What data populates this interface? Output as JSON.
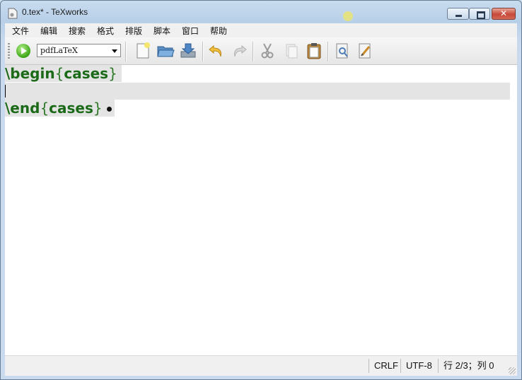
{
  "window": {
    "title": "0.tex* - TeXworks",
    "close_label": "✕"
  },
  "menu": {
    "items": [
      "文件",
      "编辑",
      "搜索",
      "格式",
      "排版",
      "脚本",
      "窗口",
      "帮助"
    ]
  },
  "toolbar": {
    "engine_value": "pdfLaTeX",
    "icons": [
      "typeset-icon",
      "new-file-icon",
      "open-folder-icon",
      "save-icon",
      "undo-icon",
      "redo-icon",
      "cut-icon",
      "copy-icon",
      "paste-icon",
      "find-icon",
      "replace-icon"
    ]
  },
  "editor": {
    "line1": {
      "command": "\\begin",
      "lbrace": "{",
      "arg": "cases",
      "rbrace": "}"
    },
    "line3": {
      "command": "\\end",
      "lbrace": "{",
      "arg": "cases",
      "rbrace": "}"
    }
  },
  "status": {
    "line_ending": "CRLF",
    "encoding": "UTF-8",
    "position": "行 2/3；列 0"
  },
  "colors": {
    "latex_green": "#1b6a18",
    "selection_gray": "#e4e4e4"
  }
}
